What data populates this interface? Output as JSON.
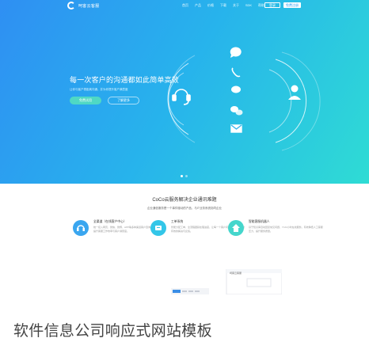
{
  "nav": {
    "logo_text": "呵客云客服",
    "menu": [
      "首页",
      "产品",
      "价格",
      "下载",
      "关于",
      "SDK",
      "帮助"
    ],
    "login": "登录",
    "register": "免费注册"
  },
  "hero": {
    "headline": "每一次客户的沟通都如此简单高效",
    "subline": "让你与客户零距离沟通，并为你提升客户满意度",
    "cta_primary": "免费试用",
    "cta_secondary": "了解更多",
    "slide_count": 2,
    "active_slide": 1,
    "channel_icons": [
      "chat-bubble-icon",
      "phone-icon",
      "weibo-icon",
      "wechat-icon",
      "mail-icon"
    ]
  },
  "section": {
    "title": "CoCo云服务解决企业通讯难题",
    "subtitle": "企业通信服务是一个事件驱动的产品，与IT业务系统协同企业",
    "features": [
      {
        "title": "全渠道（在线客户中心）",
        "desc": "统一接入网页、微信、微博、APP等多种渠道客户咨询，一站式管理，提升客服工作效率与客户满意度。",
        "icon": "headset-icon",
        "color": "#3aa6ef"
      },
      {
        "title": "工单系统",
        "desc": "智能分配工单，全流程跟踪处理进度，让每一个客户问题都能得到及时有效的解决与反馈。",
        "icon": "ticket-icon",
        "color": "#33c6e8"
      },
      {
        "title": "智能客服机器人",
        "desc": "基于知识库自动回复常见问题，7×24小时在线服务，有效降低人工客服压力，提升服务质量。",
        "icon": "robot-icon",
        "color": "#45d6cc"
      }
    ],
    "preview_label": "呵客云客服"
  },
  "caption": "软件信息公司响应式网站模板",
  "colors": {
    "gradient_start": "#2f8ff3",
    "gradient_end": "#2fdcd4",
    "accent": "#4fd8c4"
  }
}
